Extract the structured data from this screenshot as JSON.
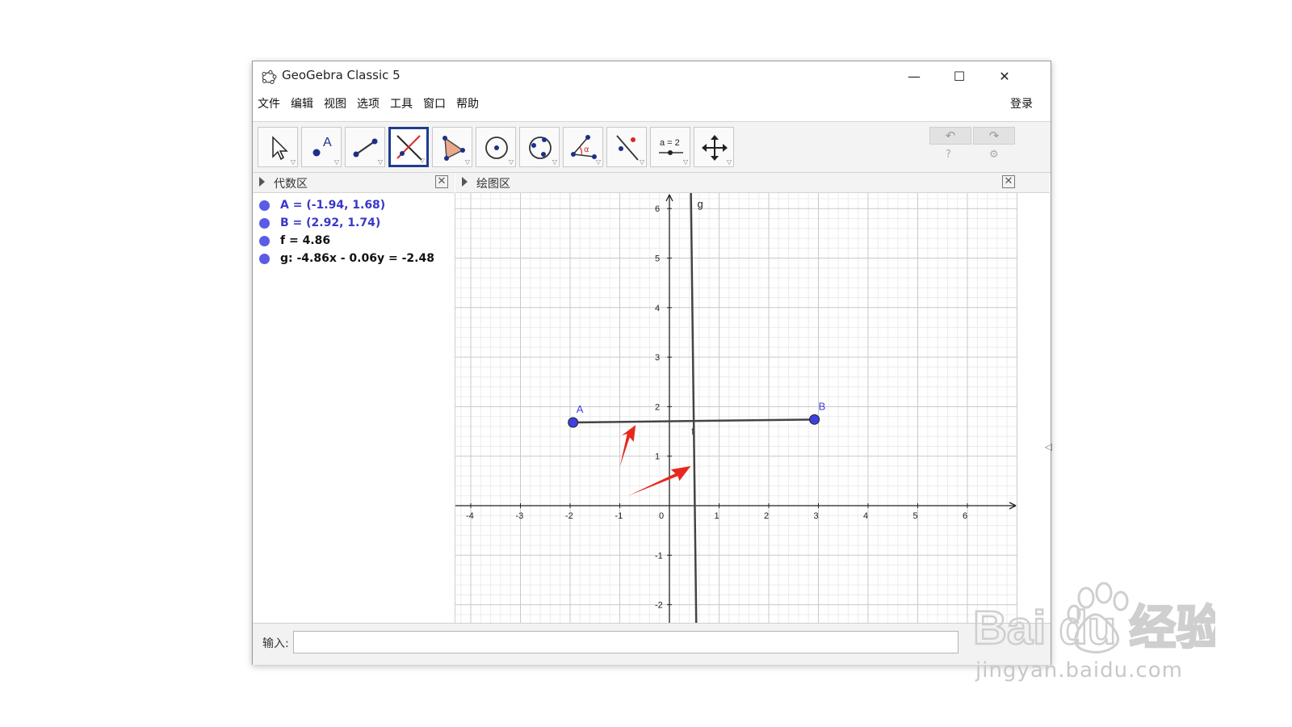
{
  "window": {
    "title": "GeoGebra Classic 5",
    "minimize_label": "—",
    "maximize_label": "☐",
    "close_label": "✕"
  },
  "menu": {
    "items": [
      "文件",
      "编辑",
      "视图",
      "选项",
      "工具",
      "窗口",
      "帮助"
    ],
    "login": "登录"
  },
  "toolbar": {
    "tools": [
      {
        "name": "move-tool-icon",
        "active": false
      },
      {
        "name": "point-tool-icon",
        "active": false
      },
      {
        "name": "segment-tool-icon",
        "active": false
      },
      {
        "name": "perpendicular-line-tool-icon",
        "active": true
      },
      {
        "name": "polygon-tool-icon",
        "active": false
      },
      {
        "name": "circle-center-point-tool-icon",
        "active": false
      },
      {
        "name": "ellipse-tool-icon",
        "active": false
      },
      {
        "name": "angle-tool-icon",
        "active": false
      },
      {
        "name": "reflect-tool-icon",
        "active": false
      },
      {
        "name": "slider-tool-icon",
        "active": false
      },
      {
        "name": "move-view-tool-icon",
        "active": false
      }
    ],
    "slider_tool_text": "a = 2",
    "undo_icon": "↶",
    "redo_icon": "↷",
    "help_icon": "?",
    "settings_icon": "⚙"
  },
  "algebra_view": {
    "title": "代数区",
    "close_label": "✕",
    "items": [
      {
        "text": "A = (-1.94, 1.68)",
        "color": "#3838c8"
      },
      {
        "text": "B = (2.92, 1.74)",
        "color": "#3838c8"
      },
      {
        "text": "f = 4.86",
        "color": "#111111"
      },
      {
        "text": "g: -4.86x - 0.06y = -2.48",
        "color": "#111111"
      }
    ]
  },
  "graphics_view": {
    "title": "绘图区",
    "close_label": "✕",
    "x_ticks": [
      "-4",
      "-3",
      "-2",
      "-1",
      "0",
      "1",
      "2",
      "3",
      "4",
      "5",
      "6"
    ],
    "y_ticks": [
      "6",
      "5",
      "4",
      "3",
      "2",
      "1",
      "-1",
      "-2"
    ],
    "point_labels": {
      "A": "A",
      "B": "B"
    },
    "segment_label": "f",
    "line_label": "g",
    "points": {
      "A": [
        -1.94,
        1.68
      ],
      "B": [
        2.92,
        1.74
      ]
    },
    "point_color": "#4040e0",
    "annotation_arrow_color": "#e8281e"
  },
  "input_bar": {
    "label": "输入:"
  },
  "watermark": {
    "brand": "Bai du 经验",
    "url": "jingyan.baidu.com"
  }
}
